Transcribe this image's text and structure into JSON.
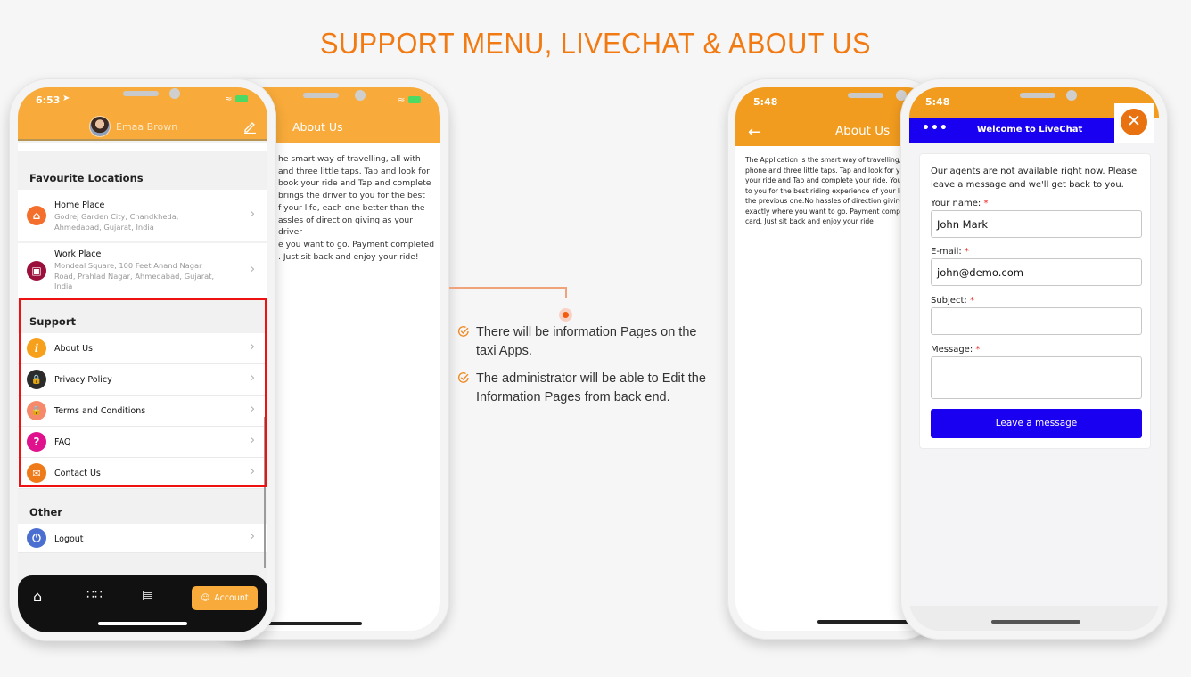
{
  "page": {
    "title": "SUPPORT MENU, LIVECHAT & ABOUT US",
    "accent_color": "#f27a12"
  },
  "support_phone": {
    "status_time": "6:53",
    "profile_name": "Emaa Brown",
    "favourites": {
      "heading": "Favourite Locations",
      "items": [
        {
          "label": "Home Place",
          "address": "Godrej Garden City, Chandkheda, Ahmedabad, Gujarat, India",
          "icon": "home-pin-icon"
        },
        {
          "label": "Work Place",
          "address": "Mondeal Square, 100 Feet Anand Nagar Road, Prahlad Nagar, Ahmedabad, Gujarat, India",
          "icon": "work-pin-icon"
        }
      ]
    },
    "support": {
      "heading": "Support",
      "items": [
        {
          "label": "About Us",
          "icon": "info-icon",
          "color": "#f7a01b"
        },
        {
          "label": "Privacy Policy",
          "icon": "privacy-lock-icon",
          "color": "#2b2b2b"
        },
        {
          "label": "Terms and Conditions",
          "icon": "lock-icon",
          "color": "#f6896a"
        },
        {
          "label": "FAQ",
          "icon": "question-icon",
          "color": "#e0118d"
        },
        {
          "label": "Contact Us",
          "icon": "mail-icon",
          "color": "#ef7a1a"
        }
      ]
    },
    "other": {
      "heading": "Other",
      "items": [
        {
          "label": "Logout",
          "icon": "power-icon",
          "color": "#4a6fd0"
        }
      ]
    },
    "tabbar": {
      "account_label": "Account"
    }
  },
  "about_phone_left": {
    "title": "About Us",
    "lines": [
      "he smart way of travelling, all with",
      "and three little taps. Tap and look for",
      "book your ride and Tap and complete",
      "brings the driver to you for the best",
      "f your life, each one better than the",
      "assles of direction giving as your driver",
      "e you want to go. Payment completed",
      ". Just sit back and enjoy your ride!"
    ]
  },
  "annotation": {
    "bullets": [
      "There will be information Pages on the taxi Apps.",
      "The administrator will be able to Edit the Information Pages from back end."
    ]
  },
  "about_phone_right": {
    "status_time": "5:48",
    "title": "About Us",
    "lines": [
      "The Application is the smart way of travelling, a",
      "phone and three little taps. Tap and look for yo",
      "your ride and Tap and complete your ride. You",
      "to you for the best riding experience of your life",
      "the previous one.No hassles of direction giving",
      "exactly where you want to go. Payment compl",
      "card. Just sit back and enjoy your ride!"
    ]
  },
  "livechat_phone": {
    "status_time": "5:48",
    "header_title": "Welcome to LiveChat",
    "notice": "Our agents are not available right now. Please leave a message and we'll get back to you.",
    "fields": {
      "name_label": "Your name:",
      "name_value": "John Mark",
      "email_label": "E-mail:",
      "email_value": "john@demo.com",
      "subject_label": "Subject:",
      "subject_value": "",
      "message_label": "Message:",
      "message_value": "",
      "required_mark": "*"
    },
    "submit_label": "Leave a message"
  }
}
